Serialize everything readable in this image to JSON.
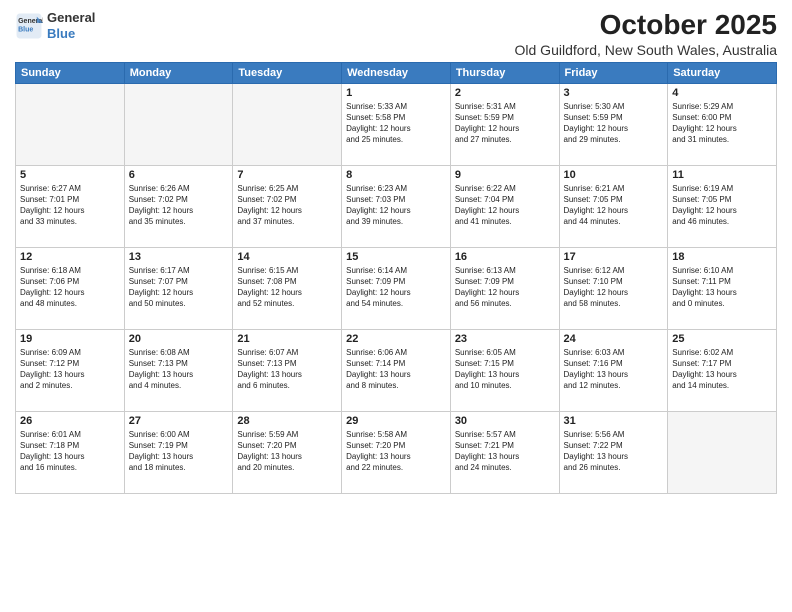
{
  "header": {
    "logo_general": "General",
    "logo_blue": "Blue",
    "month": "October 2025",
    "location": "Old Guildford, New South Wales, Australia"
  },
  "days_of_week": [
    "Sunday",
    "Monday",
    "Tuesday",
    "Wednesday",
    "Thursday",
    "Friday",
    "Saturday"
  ],
  "weeks": [
    [
      {
        "day": "",
        "content": ""
      },
      {
        "day": "",
        "content": ""
      },
      {
        "day": "",
        "content": ""
      },
      {
        "day": "1",
        "content": "Sunrise: 5:33 AM\nSunset: 5:58 PM\nDaylight: 12 hours\nand 25 minutes."
      },
      {
        "day": "2",
        "content": "Sunrise: 5:31 AM\nSunset: 5:59 PM\nDaylight: 12 hours\nand 27 minutes."
      },
      {
        "day": "3",
        "content": "Sunrise: 5:30 AM\nSunset: 5:59 PM\nDaylight: 12 hours\nand 29 minutes."
      },
      {
        "day": "4",
        "content": "Sunrise: 5:29 AM\nSunset: 6:00 PM\nDaylight: 12 hours\nand 31 minutes."
      }
    ],
    [
      {
        "day": "5",
        "content": "Sunrise: 6:27 AM\nSunset: 7:01 PM\nDaylight: 12 hours\nand 33 minutes."
      },
      {
        "day": "6",
        "content": "Sunrise: 6:26 AM\nSunset: 7:02 PM\nDaylight: 12 hours\nand 35 minutes."
      },
      {
        "day": "7",
        "content": "Sunrise: 6:25 AM\nSunset: 7:02 PM\nDaylight: 12 hours\nand 37 minutes."
      },
      {
        "day": "8",
        "content": "Sunrise: 6:23 AM\nSunset: 7:03 PM\nDaylight: 12 hours\nand 39 minutes."
      },
      {
        "day": "9",
        "content": "Sunrise: 6:22 AM\nSunset: 7:04 PM\nDaylight: 12 hours\nand 41 minutes."
      },
      {
        "day": "10",
        "content": "Sunrise: 6:21 AM\nSunset: 7:05 PM\nDaylight: 12 hours\nand 44 minutes."
      },
      {
        "day": "11",
        "content": "Sunrise: 6:19 AM\nSunset: 7:05 PM\nDaylight: 12 hours\nand 46 minutes."
      }
    ],
    [
      {
        "day": "12",
        "content": "Sunrise: 6:18 AM\nSunset: 7:06 PM\nDaylight: 12 hours\nand 48 minutes."
      },
      {
        "day": "13",
        "content": "Sunrise: 6:17 AM\nSunset: 7:07 PM\nDaylight: 12 hours\nand 50 minutes."
      },
      {
        "day": "14",
        "content": "Sunrise: 6:15 AM\nSunset: 7:08 PM\nDaylight: 12 hours\nand 52 minutes."
      },
      {
        "day": "15",
        "content": "Sunrise: 6:14 AM\nSunset: 7:09 PM\nDaylight: 12 hours\nand 54 minutes."
      },
      {
        "day": "16",
        "content": "Sunrise: 6:13 AM\nSunset: 7:09 PM\nDaylight: 12 hours\nand 56 minutes."
      },
      {
        "day": "17",
        "content": "Sunrise: 6:12 AM\nSunset: 7:10 PM\nDaylight: 12 hours\nand 58 minutes."
      },
      {
        "day": "18",
        "content": "Sunrise: 6:10 AM\nSunset: 7:11 PM\nDaylight: 13 hours\nand 0 minutes."
      }
    ],
    [
      {
        "day": "19",
        "content": "Sunrise: 6:09 AM\nSunset: 7:12 PM\nDaylight: 13 hours\nand 2 minutes."
      },
      {
        "day": "20",
        "content": "Sunrise: 6:08 AM\nSunset: 7:13 PM\nDaylight: 13 hours\nand 4 minutes."
      },
      {
        "day": "21",
        "content": "Sunrise: 6:07 AM\nSunset: 7:13 PM\nDaylight: 13 hours\nand 6 minutes."
      },
      {
        "day": "22",
        "content": "Sunrise: 6:06 AM\nSunset: 7:14 PM\nDaylight: 13 hours\nand 8 minutes."
      },
      {
        "day": "23",
        "content": "Sunrise: 6:05 AM\nSunset: 7:15 PM\nDaylight: 13 hours\nand 10 minutes."
      },
      {
        "day": "24",
        "content": "Sunrise: 6:03 AM\nSunset: 7:16 PM\nDaylight: 13 hours\nand 12 minutes."
      },
      {
        "day": "25",
        "content": "Sunrise: 6:02 AM\nSunset: 7:17 PM\nDaylight: 13 hours\nand 14 minutes."
      }
    ],
    [
      {
        "day": "26",
        "content": "Sunrise: 6:01 AM\nSunset: 7:18 PM\nDaylight: 13 hours\nand 16 minutes."
      },
      {
        "day": "27",
        "content": "Sunrise: 6:00 AM\nSunset: 7:19 PM\nDaylight: 13 hours\nand 18 minutes."
      },
      {
        "day": "28",
        "content": "Sunrise: 5:59 AM\nSunset: 7:20 PM\nDaylight: 13 hours\nand 20 minutes."
      },
      {
        "day": "29",
        "content": "Sunrise: 5:58 AM\nSunset: 7:20 PM\nDaylight: 13 hours\nand 22 minutes."
      },
      {
        "day": "30",
        "content": "Sunrise: 5:57 AM\nSunset: 7:21 PM\nDaylight: 13 hours\nand 24 minutes."
      },
      {
        "day": "31",
        "content": "Sunrise: 5:56 AM\nSunset: 7:22 PM\nDaylight: 13 hours\nand 26 minutes."
      },
      {
        "day": "",
        "content": ""
      }
    ]
  ]
}
